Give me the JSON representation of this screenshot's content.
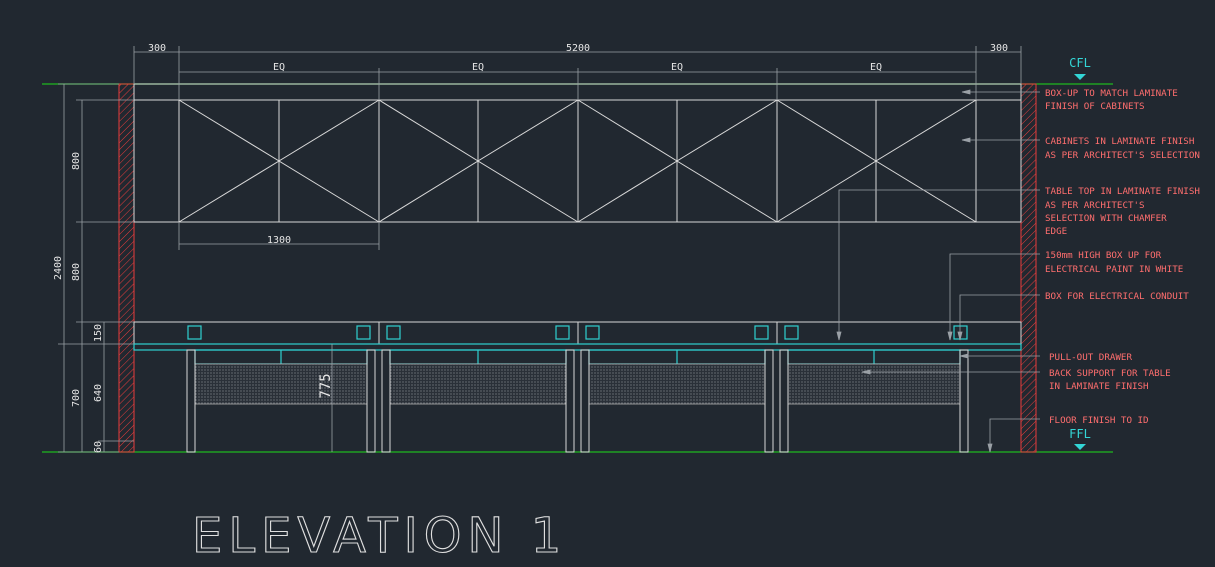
{
  "title": "ELEVATION 1",
  "colors": {
    "background": "#212830",
    "lines": "#d8d8d8",
    "notes": "#ff6e6e",
    "levels": "#33d6d6",
    "floor_line": "#1fb81f",
    "wall_hatch": "#e63c3c"
  },
  "levels": {
    "ceiling": "CFL",
    "floor": "FFL"
  },
  "top_dims": {
    "left": "300",
    "overall": "5200",
    "right": "300",
    "eq": [
      "EQ",
      "EQ",
      "EQ",
      "EQ"
    ]
  },
  "cabinet_dim": "1300",
  "left_dims": {
    "total": "2400",
    "upper": "800",
    "mid": "800",
    "boxup": "150",
    "lower": "700",
    "table": "640",
    "base": "60"
  },
  "table_height": "775",
  "notes": [
    [
      "BOX-UP TO MATCH LAMINATE",
      "FINISH OF CABINETS"
    ],
    [
      "CABINETS IN LAMINATE FINISH",
      "AS PER ARCHITECT'S SELECTION"
    ],
    [
      "TABLE TOP IN LAMINATE FINISH",
      "AS PER ARCHITECT'S",
      "SELECTION WITH CHAMFER",
      "EDGE"
    ],
    [
      "150mm HIGH BOX UP FOR",
      "ELECTRICAL PAINT IN WHITE"
    ],
    [
      "BOX FOR ELECTRICAL CONDUIT"
    ],
    [
      "PULL-OUT DRAWER"
    ],
    [
      "BACK SUPPORT FOR TABLE",
      "IN LAMINATE FINISH"
    ],
    [
      "FLOOR FINISH TO ID"
    ]
  ]
}
